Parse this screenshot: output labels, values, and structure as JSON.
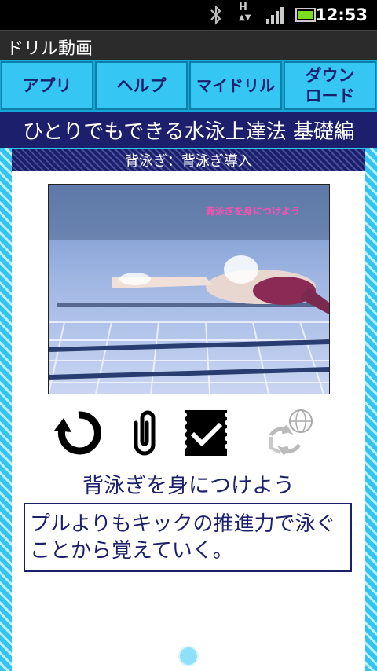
{
  "status_bar": {
    "time": "12:53",
    "icons": [
      "bluetooth-icon",
      "hsdpa-icon",
      "signal-icon",
      "battery-icon"
    ],
    "network_label": "H"
  },
  "app": {
    "title": "ドリル動画"
  },
  "nav": [
    {
      "label": "アプリ"
    },
    {
      "label": "ヘルプ"
    },
    {
      "label": "マイドリル"
    },
    {
      "label": "ダウン\nロード"
    }
  ],
  "banner": {
    "title": "ひとりでもできる水泳上達法 基礎編"
  },
  "lesson": {
    "chapter": "背泳ぎ：背泳ぎ導入",
    "video_caption": "背泳ぎを身につけよう",
    "title": "背泳ぎを身につけよう",
    "description": "プルよりもキックの推進力で泳ぐことから覚えていく。"
  },
  "actions": [
    "replay-icon",
    "clip-icon",
    "checked-document-icon",
    "globe-sync-icon"
  ],
  "colors": {
    "navy": "#1c1f6b",
    "sky": "#36c6f4",
    "stripe": "#33c4f2"
  }
}
